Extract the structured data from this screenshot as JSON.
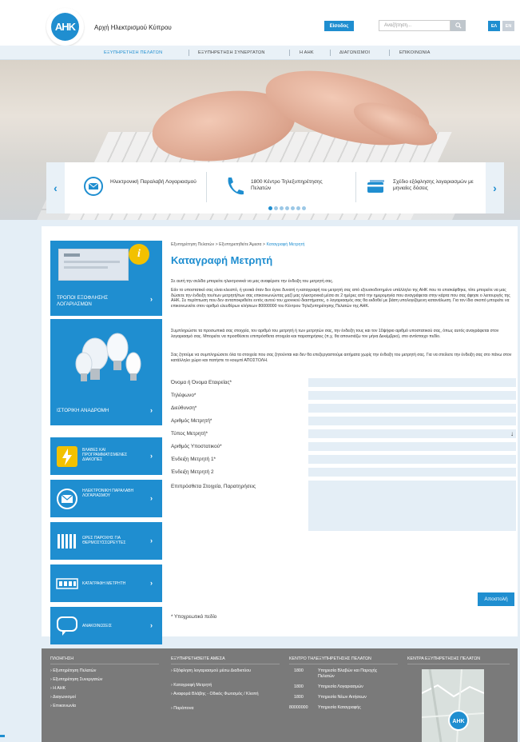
{
  "brand": {
    "logo_text": "AHK",
    "name": "Αρχή Ηλεκτρισμού Κύπρου"
  },
  "header": {
    "login_label": "Είσοδος",
    "search_placeholder": "Αναζήτηση...",
    "lang_el": "ΕΛ",
    "lang_en": "EN"
  },
  "nav": {
    "items": [
      {
        "label": "ΕΞΥΠΗΡΕΤΗΣΗ ΠΕΛΑΤΩΝ",
        "active": true
      },
      {
        "label": "ΕΞΥΠΗΡΕΤΗΣΗ ΣΥΝΕΡΓΑΤΩΝ"
      },
      {
        "label": "Η ΑΗΚ"
      },
      {
        "label": "ΔΙΑΓΩΝΙΣΜΟΙ"
      },
      {
        "label": "ΕΠΙΚΟΙΝΩΝΙΑ"
      }
    ]
  },
  "slider": {
    "prev": "‹",
    "next": "›",
    "slides": [
      {
        "icon": "envelope-icon",
        "text": "Ηλεκτρονική Παραλαβή Λογαριασμού"
      },
      {
        "icon": "phone-icon",
        "text": "1800 Κέντρο Τηλεξυπηρέτησης Πελατών"
      },
      {
        "icon": "card-icon",
        "text": "Σχέδιο εξόφλησης λογαριασμών με μηνιαίες δόσεις"
      }
    ],
    "dots_count": 7,
    "active_dot": 0
  },
  "sidebar": {
    "payment": "ΤΡΟΠΟΙ ΕΞΟΦΛΗΣΗΣ ΛΟΓΑΡΙΑΣΜΩΝ",
    "history": "ΙΣΤΟΡΙΚΗ ΑΝΑΔΡΟΜΗ",
    "items": [
      {
        "icon": "lightning-icon",
        "label": "ΒΛΑΒΕΣ ΚΑΙ ΠΡΟΓΡΑΜΜΑΤΙΣΜΕΝΕΣ ΔΙΑΚΟΠΕΣ"
      },
      {
        "icon": "mail-icon",
        "label": "ΗΛΕΚΤΡΟΝΙΚΗ ΠΑΡΑΛΑΒΗ ΛΟΓΑΡΙΑΣΜΟΥ"
      },
      {
        "icon": "radiator-icon",
        "label": "ΩΡΕΣ ΠΑΡΟΧΗΣ ΓΙΑ ΘΕΡΜΟΣΥΣΣΩΡΕΥΤΕΣ"
      },
      {
        "icon": "meter-icon",
        "label": "ΚΑΤΑΓΡΑΦΗ ΜΕΤΡΗΤΗ"
      },
      {
        "icon": "speech-icon",
        "label": "ΑΝΑΚΟΙΝΩΣΕΙΣ"
      }
    ],
    "chevron": "›"
  },
  "breadcrumb": {
    "part1": "Εξυπηρέτηση Πελατών",
    "sep": " > ",
    "part2": "Εξυπηρετηθείτε Άμεσα",
    "current": "Καταγραφή Μετρητή"
  },
  "page": {
    "title": "Καταγραφή Μετρητή",
    "p1": "Σε αυτή την σελίδα μπορείτε ηλεκτρονικά να μας αναφέρετε την ένδειξη του μετρητή σας.",
    "p2": "Εάν το υποστατικό σας είναι κλειστό, ή γενικά όταν δεν έγινε δυνατή η καταγραφή του μετρητή σας από εξουσιοδοτημένο υπάλληλο της ΑΗΚ που το επισκέφθηκε, τότε μπορείτε να μας δώσετε την ένδειξη του/των μετρητή/των σας επικοινωνώντας μαζί μας ηλεκτρονικά μέσα σε 2 ημέρες από την ημερομηνία που αναγράφεται στην κάρτα που σας άφησε ο λειτουργός της ΑΗΚ. Σε περίπτωση που δεν ανταποκριθείτε εντός αυτού του χρονικού διαστήματος, ο λογαριασμός σας θα εκδοθεί με βάση υπολογιζόμενη κατανάλωση. Για τον ίδιο σκοπό μπορείτε να επικοινωνείτε στον αριθμό ελευθέρων κλήσεων 80000000 του Κέντρου Τηλεξυπηρέτησης Πελατών της ΑΗΚ.",
    "p3": "Συμπληρώστε τα προσωπικά σας στοιχεία, τον αριθμό του μετρητή ή των μετρητών σας, την ένδειξη τους και τον 10ψήφιο αριθμό υποστατικού σας, όπως αυτός αναγράφεται στον λογαριασμό σας. Μπορείτε να προσθέσετε επιπρόσθετα στοιχεία και παρατηρήσεις (π.χ. θα απουσιάζω τον μήνα Δεκέμβριο), στο αντίστοιχο πεδίο.",
    "p4": " Σας ζητούμε να συμπληρώσετε όλα τα στοιχεία που σας ζητούνται και δεν θα επεξεργαστούμε αιτήματα χωρίς την ένδειξη του μετρητή σας. Για να στείλετε την ένδειξη σας στο πάνω στον κατάλληλο χώρο και πατήστε το κουμπί ΑΠΟΣΤΟΛΗ."
  },
  "form": {
    "fields": [
      {
        "label": "Όνομα ή Όνομα Εταιρείας*"
      },
      {
        "label": "Τηλέφωνο*"
      },
      {
        "label": "Διεύθυνση*"
      },
      {
        "label": "Αριθμός Μετρητή*"
      },
      {
        "label": "Τύπος Μετρητή*",
        "select": true
      },
      {
        "label": "Αριθμός Υποστατικού*"
      },
      {
        "label": "Ένδειξη Μετρητή 1*"
      },
      {
        "label": "Ένδειξη Μετρητή 2"
      }
    ],
    "notes_label": "Επιπρόσθετα Στοιχεία, Παρατηρήσεις",
    "submit_label": "Αποστολή",
    "required_note": "* Υποχρεωτικό πεδίο"
  },
  "footer": {
    "col1": {
      "title": "ΠΛΟΗΓΗΣΗ",
      "items": [
        "Εξυπηρέτηση Πελατών",
        "Εξυπηρέτηση Συνεργατών",
        "Η ΑΗΚ",
        "Διαγωνισμοί",
        "Επικοινωνία"
      ]
    },
    "col2": {
      "title": "ΕΞΥΠΗΡΕΤΗΘΕΙΤΕ ΑΜΕΣΑ",
      "items": [
        "Εξόφληση λογαριασμού μέσω Διαδικτύου",
        "Καταγραφή Μετρητή",
        "Αναφορά Βλάβης - Οδικός Φωτισμός / Κλοπή",
        "Παράπονα"
      ]
    },
    "col3": {
      "title": "ΚΕΝΤΡΟ ΤΗΛΕΞΥΠΗΡΕΤΗΣΗΣ ΠΕΛΑΤΩΝ",
      "rows": [
        {
          "num": "1800",
          "text": "Υπηρεσία Βλαβών και Παροχής Πελατών"
        },
        {
          "num": "1800",
          "text": "Υπηρεσία Λογαριασμών"
        },
        {
          "num": "1800",
          "text": "Υπηρεσία Νέων Αιτήσεων"
        },
        {
          "num": "80000000",
          "text": "Υπηρεσία Καταγραφής"
        }
      ]
    },
    "col4": {
      "title": "ΚΕΝΤΡΑ ΕΞΥΠΗΡΕΤΗΣΗΣ ΠΕΛΑΤΩΝ"
    }
  },
  "colors": {
    "accent": "#1f8ed0",
    "footer": "#7a7a7a",
    "field": "#e4eef6"
  }
}
